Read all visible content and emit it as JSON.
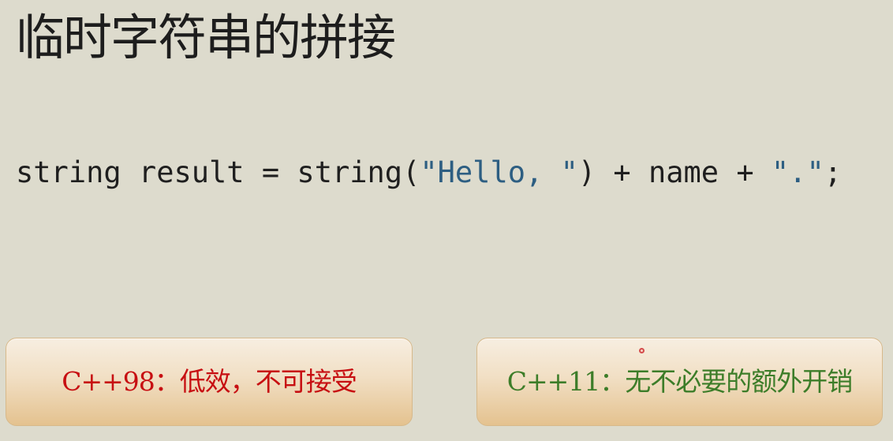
{
  "slide": {
    "title": "临时字符串的拼接",
    "code": {
      "part1": "string result = string(",
      "string1": "\"Hello, \"",
      "part2": ") + name + ",
      "string2": "\".\"",
      "part3": ";"
    },
    "callouts": [
      {
        "text": "C++98：低效，不可接受"
      },
      {
        "text": "C++11：无不必要的额外开销"
      }
    ]
  },
  "colors": {
    "background": "#dddbcd",
    "title": "#1d1d1d",
    "code_text": "#1f1f1f",
    "code_string": "#2d5e82",
    "callout_left_text": "#c70f12",
    "callout_right_text": "#3d7d29",
    "callout_fill_top": "#f7eee1",
    "callout_fill_bottom": "#e4c28f"
  }
}
